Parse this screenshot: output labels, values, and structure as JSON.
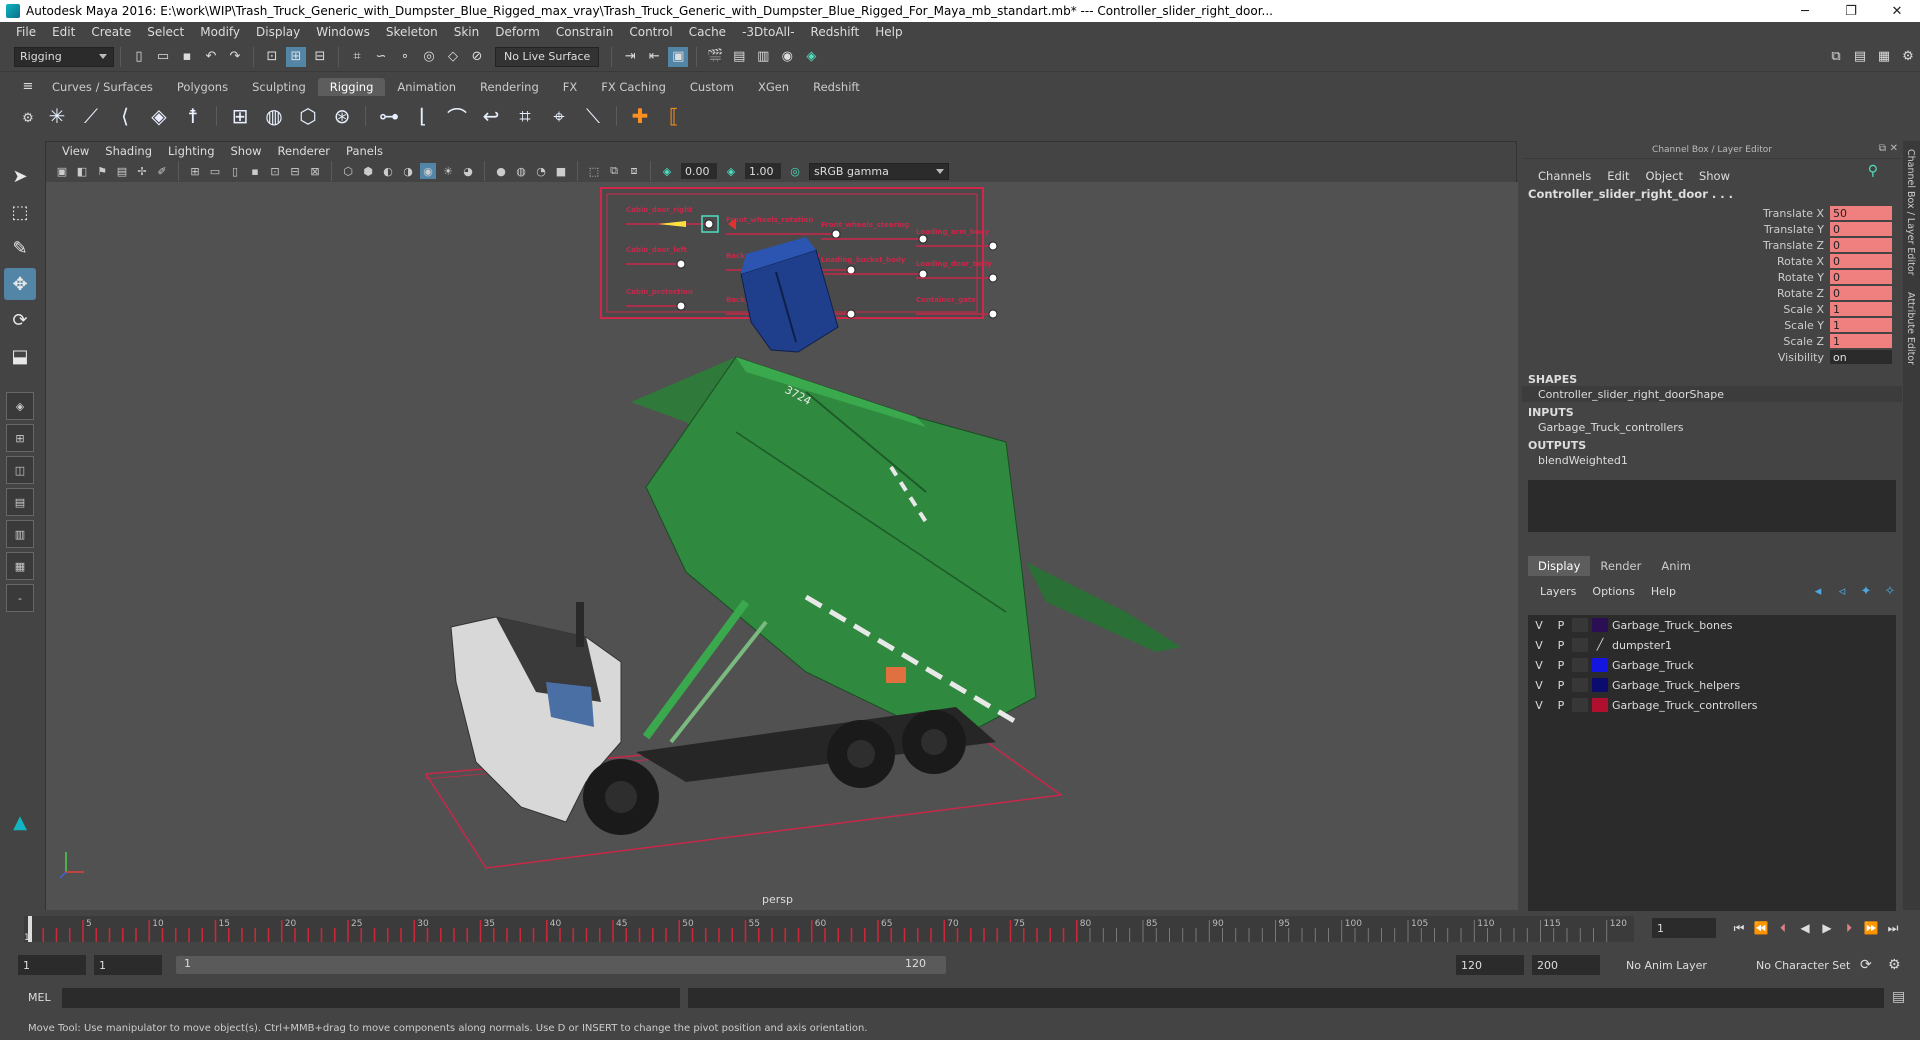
{
  "titlebar": {
    "title": "Autodesk Maya 2016: E:\\work\\WIP\\Trash_Truck_Generic_with_Dumpster_Blue_Rigged_max_vray\\Trash_Truck_Generic_with_Dumpster_Blue_Rigged_For_Maya_mb_standart.mb*   ---   Controller_slider_right_door...",
    "minimize": "─",
    "maximize": "❐",
    "close": "✕"
  },
  "menubar": [
    "File",
    "Edit",
    "Create",
    "Select",
    "Modify",
    "Display",
    "Windows",
    "Skeleton",
    "Skin",
    "Deform",
    "Constrain",
    "Control",
    "Cache",
    "-3DtoAll-",
    "Redshift",
    "Help"
  ],
  "statusline": {
    "mode": "Rigging",
    "live_surface": "No Live Surface"
  },
  "shelf_tabs": [
    "Curves / Surfaces",
    "Polygons",
    "Sculpting",
    "Rigging",
    "Animation",
    "Rendering",
    "FX",
    "FX Caching",
    "Custom",
    "XGen",
    "Redshift"
  ],
  "active_shelf": "Rigging",
  "viewport": {
    "menu": [
      "View",
      "Shading",
      "Lighting",
      "Show",
      "Renderer",
      "Panels"
    ],
    "exposure": "0.00",
    "gamma": "1.00",
    "color_space": "sRGB gamma",
    "camera": "persp",
    "controller_labels": [
      "Cabin_door_right",
      "Front_wheels_rotation",
      "Front_wheels_steering",
      "Loading_arm_body",
      "Cabin_door_left",
      "Back_wheels_1_rotation",
      "Loading_bucket_body",
      "Loading_door_body",
      "Cabin_protection",
      "Back_wheels_2",
      "Container_gate"
    ],
    "truck_number": "3724"
  },
  "channelbox": {
    "header": "Channel Box / Layer Editor",
    "menu": [
      "Channels",
      "Edit",
      "Object",
      "Show"
    ],
    "object_name": "Controller_slider_right_door . . .",
    "attributes": [
      {
        "label": "Translate X",
        "value": "50",
        "keyed": true
      },
      {
        "label": "Translate Y",
        "value": "0",
        "keyed": true
      },
      {
        "label": "Translate Z",
        "value": "0",
        "keyed": true
      },
      {
        "label": "Rotate X",
        "value": "0",
        "keyed": true
      },
      {
        "label": "Rotate Y",
        "value": "0",
        "keyed": true
      },
      {
        "label": "Rotate Z",
        "value": "0",
        "keyed": true
      },
      {
        "label": "Scale X",
        "value": "1",
        "keyed": true
      },
      {
        "label": "Scale Y",
        "value": "1",
        "keyed": true
      },
      {
        "label": "Scale Z",
        "value": "1",
        "keyed": true
      },
      {
        "label": "Visibility",
        "value": "on",
        "keyed": false
      }
    ],
    "shapes_head": "SHAPES",
    "shape": "Controller_slider_right_doorShape",
    "inputs_head": "INPUTS",
    "input": "Garbage_Truck_controllers",
    "outputs_head": "OUTPUTS",
    "output": "blendWeighted1"
  },
  "layer_editor": {
    "tabs": [
      "Display",
      "Render",
      "Anim"
    ],
    "active_tab": "Display",
    "menu": [
      "Layers",
      "Options",
      "Help"
    ],
    "layers": [
      {
        "v": "V",
        "p": "P",
        "color": "#2a0f55",
        "name": "Garbage_Truck_bones",
        "swatch": "color"
      },
      {
        "v": "V",
        "p": "P",
        "color": "",
        "name": "dumpster1",
        "swatch": "slash"
      },
      {
        "v": "V",
        "p": "P",
        "color": "#1515e0",
        "name": "Garbage_Truck",
        "swatch": "color"
      },
      {
        "v": "V",
        "p": "P",
        "color": "#0c0c6e",
        "name": "Garbage_Truck_helpers",
        "swatch": "color"
      },
      {
        "v": "V",
        "p": "P",
        "color": "#b01030",
        "name": "Garbage_Truck_controllers",
        "swatch": "color"
      }
    ]
  },
  "side_tabs": [
    "Channel Box / Layer Editor",
    "Attribute Editor"
  ],
  "timeslider": {
    "ticks": [
      "5",
      "10",
      "15",
      "20",
      "25",
      "30",
      "35",
      "40",
      "45",
      "50",
      "55",
      "60",
      "65",
      "70",
      "75",
      "80",
      "85",
      "90",
      "95",
      "100",
      "105",
      "110",
      "115",
      "120"
    ],
    "start_label": "1",
    "current_frame": "1",
    "keyed_until": 80,
    "max_frame": 120
  },
  "rangeslider": {
    "start": "1",
    "playback_start": "1",
    "bar_left": "1",
    "bar_right": "120",
    "playback_end": "120",
    "end": "200",
    "anim_layer": "No Anim Layer",
    "character_set": "No Character Set"
  },
  "cmdline": {
    "label": "MEL"
  },
  "helpline": {
    "text": "Move Tool: Use manipulator to move object(s). Ctrl+MMB+drag to move components along normals. Use D or INSERT to change the pivot position and axis orientation."
  }
}
